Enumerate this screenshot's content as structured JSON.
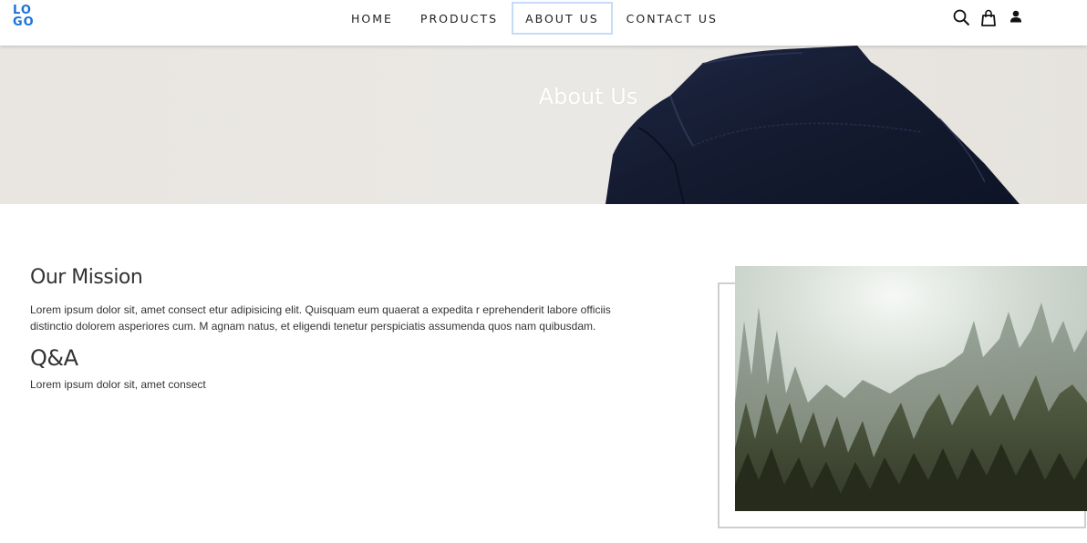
{
  "header": {
    "logo_line1": "LO",
    "logo_line2": "GO",
    "nav": [
      {
        "label": "HOME",
        "active": false
      },
      {
        "label": "PRODUCTS",
        "active": false
      },
      {
        "label": "ABOUT US",
        "active": true
      },
      {
        "label": "CONTACT US",
        "active": false
      }
    ],
    "icons": [
      "search-icon",
      "shopping-bag-icon",
      "user-icon"
    ],
    "logo_color": "#1a73d9"
  },
  "hero": {
    "title": "About Us",
    "jacket_color": "#161d33"
  },
  "content": {
    "mission_heading": "Our Mission",
    "mission_text": "Lorem ipsum dolor sit, amet consect etur adipisicing elit. Quisquam eum quaerat a expedita r eprehenderit labore officiis distinctio dolorem asperiores cum. M agnam natus, et eligendi tenetur perspiciatis assumenda quos nam quibusdam.",
    "qa_heading": "Q&A",
    "qa_text": "Lorem ipsum dolor sit, amet consect"
  }
}
